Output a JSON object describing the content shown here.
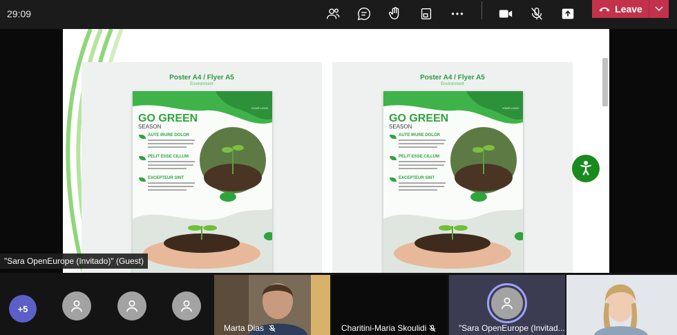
{
  "call": {
    "timer": "29:09",
    "leave_label": "Leave"
  },
  "toolbar": {
    "items": [
      "people-icon",
      "chat-icon",
      "raise-hand-icon",
      "share-tray-icon",
      "more-icon",
      "camera-icon",
      "mic-off-icon",
      "share-screen-icon"
    ]
  },
  "share": {
    "cards": [
      {
        "title": "Poster A4 / Flyer A5",
        "subtitle": "Environment",
        "poster": {
          "headline": "GO GREEN",
          "season": "SEASON",
          "logo": "YOUR LOGO",
          "sections": [
            "AUTE IRURE DOLOR",
            "PELIT ESSE CILLUM",
            "EXCEPTEUR SINT"
          ]
        }
      },
      {
        "title": "Poster A4 / Flyer A5",
        "subtitle": "Environment",
        "poster": {
          "headline": "GO GREEN",
          "season": "SEASON",
          "logo": "YOUR LOGO",
          "sections": [
            "AUTE IRURE DOLOR",
            "PELIT ESSE CILLUM",
            "EXCEPTEUR SINT"
          ]
        }
      }
    ],
    "presenter_label": "\"Sara OpenEurope (Invitado)\" (Guest)"
  },
  "participants": {
    "overflow_count": "+5",
    "tiles": [
      {
        "name": "Marta Dias",
        "muted": true
      },
      {
        "name": "Charitini-Maria Skoulidi",
        "muted": true
      },
      {
        "name": "\"Sara OpenEurope (Invitad...",
        "muted": false
      }
    ]
  },
  "colors": {
    "leave": "#c4314b",
    "brand_green": "#2fa43d",
    "accessibility": "#1a8a1f",
    "overflow": "#5b5fc7",
    "speaking_ring": "#9ea2ff"
  }
}
